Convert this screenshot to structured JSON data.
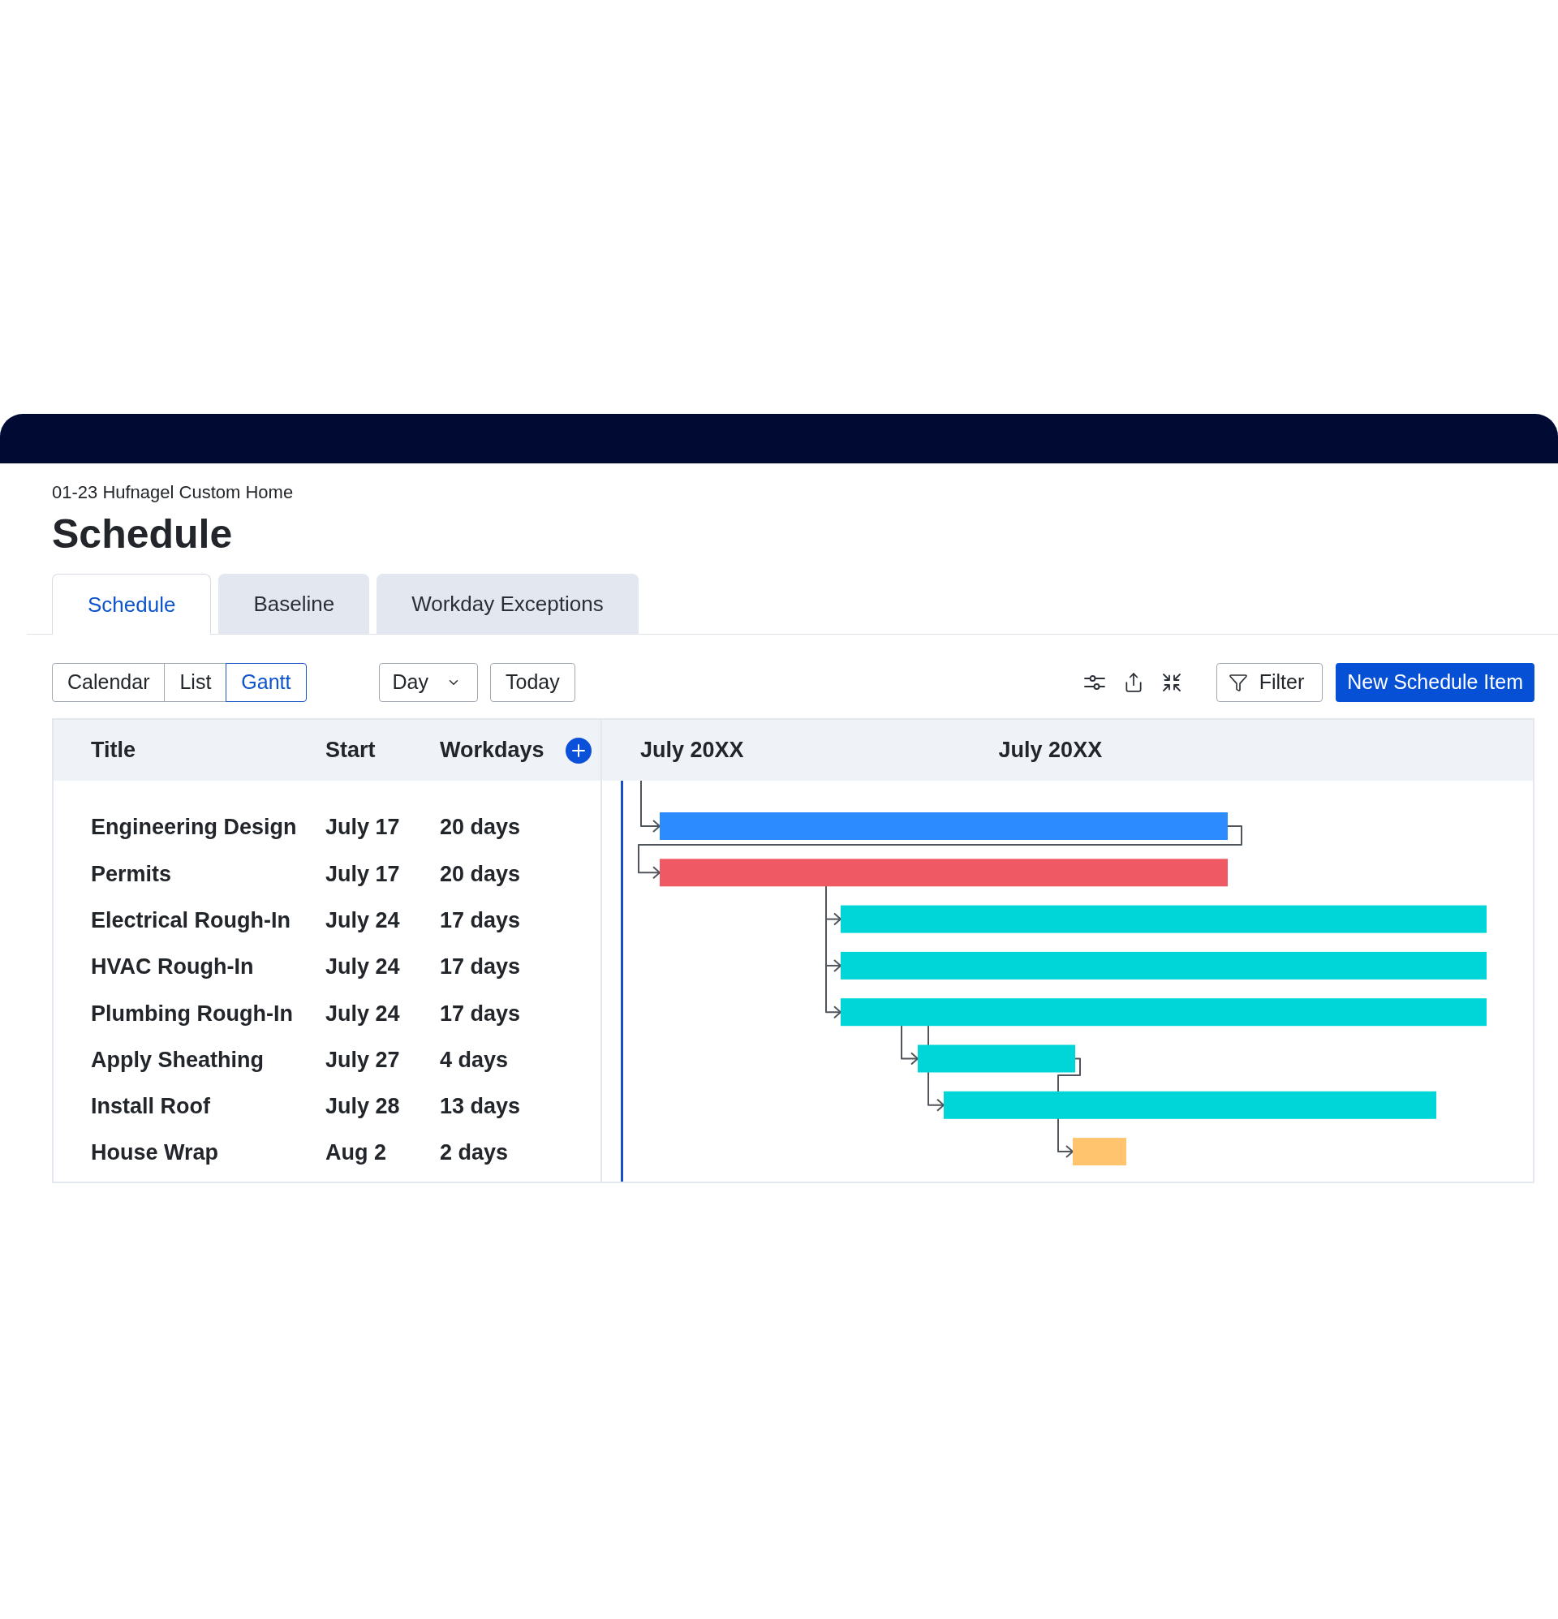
{
  "project": "01-23 Hufnagel Custom Home",
  "page_title": "Schedule",
  "tabs": [
    {
      "label": "Schedule",
      "selected": true
    },
    {
      "label": "Baseline",
      "selected": false
    },
    {
      "label": "Workday Exceptions",
      "selected": false
    }
  ],
  "toolbar": {
    "views": [
      {
        "label": "Calendar",
        "selected": false
      },
      {
        "label": "List",
        "selected": false
      },
      {
        "label": "Gantt",
        "selected": true
      }
    ],
    "zoom_dropdown": "Day",
    "today_button": "Today",
    "filter_button": "Filter",
    "new_button": "New Schedule Item"
  },
  "table": {
    "columns": [
      "Title",
      "Start",
      "Workdays"
    ],
    "tasks": [
      {
        "title": "Engineering Design",
        "start": "July 17",
        "workdays": "20 days",
        "color": "#2b8bff"
      },
      {
        "title": "Permits",
        "start": "July 17",
        "workdays": "20 days",
        "color": "#ef5964"
      },
      {
        "title": "Electrical Rough-In",
        "start": "July 24",
        "workdays": "17 days",
        "color": "#00d5d8"
      },
      {
        "title": "HVAC Rough-In",
        "start": "July 24",
        "workdays": "17 days",
        "color": "#00d5d8"
      },
      {
        "title": "Plumbing Rough-In",
        "start": "July 24",
        "workdays": "17 days",
        "color": "#00d5d8"
      },
      {
        "title": "Apply Sheathing",
        "start": "July 27",
        "workdays": "4 days",
        "color": "#00d5d8"
      },
      {
        "title": "Install Roof",
        "start": "July 28",
        "workdays": "13 days",
        "color": "#00d5d8"
      },
      {
        "title": "House Wrap",
        "start": "Aug 2",
        "workdays": "2 days",
        "color": "#ffc46d"
      }
    ]
  },
  "timeline": {
    "periods": [
      "July 20XX",
      "July 20XX"
    ]
  }
}
